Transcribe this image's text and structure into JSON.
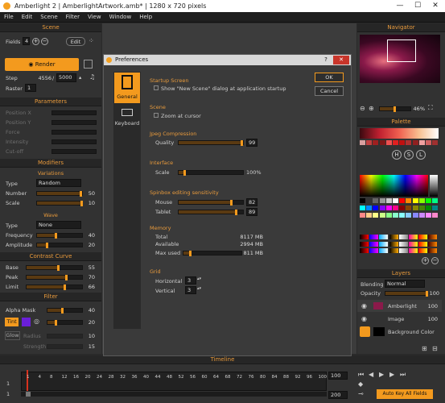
{
  "window": {
    "title": "Amberlight 2 | AmberlightArtwork.amb* | 1280 x 720 pixels",
    "min": "—",
    "max": "☐",
    "close": "✕"
  },
  "menu": [
    "File",
    "Edit",
    "Scene",
    "Filter",
    "View",
    "Window",
    "Help"
  ],
  "scene": {
    "header": "Scene",
    "fields_label": "Fields",
    "fields_value": "4",
    "edit_label": "Edit",
    "render_label": "Render",
    "step_label": "Step",
    "step_value": "4556",
    "step_total": "5000",
    "raster_label": "Raster",
    "raster_value": "1"
  },
  "parameters": {
    "header": "Parameters",
    "items": [
      "Position X",
      "Position Y",
      "Force",
      "Intensity",
      "Cut-off"
    ]
  },
  "modifiers": {
    "header": "Modifiers",
    "variations_label": "Variations",
    "type_label": "Type",
    "type_value": "Random",
    "number_label": "Number",
    "number_value": "50",
    "scale_label": "Scale",
    "scale_value": "10"
  },
  "wave": {
    "header": "Wave",
    "type_label": "Type",
    "type_value": "None",
    "frequency_label": "Frequency",
    "frequency_value": "40",
    "amplitude_label": "Amplitude",
    "amplitude_value": "20"
  },
  "contrast": {
    "header": "Contrast Curve",
    "base_label": "Base",
    "base_value": "55",
    "peak_label": "Peak",
    "peak_value": "70",
    "limit_label": "Limit",
    "limit_value": "66"
  },
  "filter": {
    "header": "Filter",
    "alpha_label": "Alpha Mask",
    "alpha_value": "40",
    "tint_label": "Tint",
    "tint_value": "20",
    "glow_label": "Glow",
    "radius_label": "Radius",
    "radius_value": "10",
    "strength_label": "Strength",
    "strength_value": "15",
    "tint_color": "#6a1fd8"
  },
  "navigator": {
    "header": "Navigator",
    "zoom": "46%"
  },
  "palette": {
    "header": "Palette"
  },
  "layers": {
    "header": "Layers",
    "blending_label": "Blending",
    "blending_value": "Normal",
    "opacity_label": "Opacity",
    "opacity_value": "100",
    "items": [
      {
        "name": "Amberlight",
        "value": "100"
      },
      {
        "name": "Image",
        "value": "100"
      },
      {
        "name": "Background Color",
        "value": ""
      }
    ]
  },
  "timeline": {
    "header": "Timeline",
    "row1_start": "1",
    "row2_start": "1",
    "ticks": [
      "1",
      "4",
      "8",
      "12",
      "16",
      "20",
      "24",
      "28",
      "32",
      "36",
      "40",
      "44",
      "48",
      "52",
      "56",
      "60",
      "64",
      "68",
      "72",
      "76",
      "80",
      "84",
      "88",
      "92",
      "96",
      "100"
    ],
    "field1": "100",
    "field2": "200",
    "autokey_label": "Auto Key All Fields"
  },
  "dialog": {
    "title": "Preferences",
    "help": "?",
    "close": "✕",
    "tabs": [
      "General",
      "Keyboard"
    ],
    "startup_header": "Startup Screen",
    "startup_check": "Show \"New Scene\" dialog at application startup",
    "scene_header": "Scene",
    "scene_check": "Zoom at cursor",
    "jpeg_header": "Jpeg Compression",
    "quality_label": "Quality",
    "quality_value": "99",
    "interface_header": "Interface",
    "scale_label": "Scale",
    "scale_value": "100%",
    "spinbox_header": "Spinbox editing sensitivity",
    "mouse_label": "Mouse",
    "mouse_value": "82",
    "tablet_label": "Tablet",
    "tablet_value": "89",
    "memory_header": "Memory",
    "total_label": "Total",
    "total_value": "8117 MB",
    "available_label": "Available",
    "available_value": "2994 MB",
    "maxused_label": "Max used",
    "maxused_value": "811 MB",
    "grid_header": "Grid",
    "horizontal_label": "Horizontal",
    "horizontal_value": "3",
    "vertical_label": "Vertical",
    "vertical_value": "3",
    "ok_label": "OK",
    "cancel_label": "Cancel"
  },
  "colors": {
    "accent": "#f39a1e",
    "header_text": "#e89a3c",
    "panel": "#323232"
  }
}
